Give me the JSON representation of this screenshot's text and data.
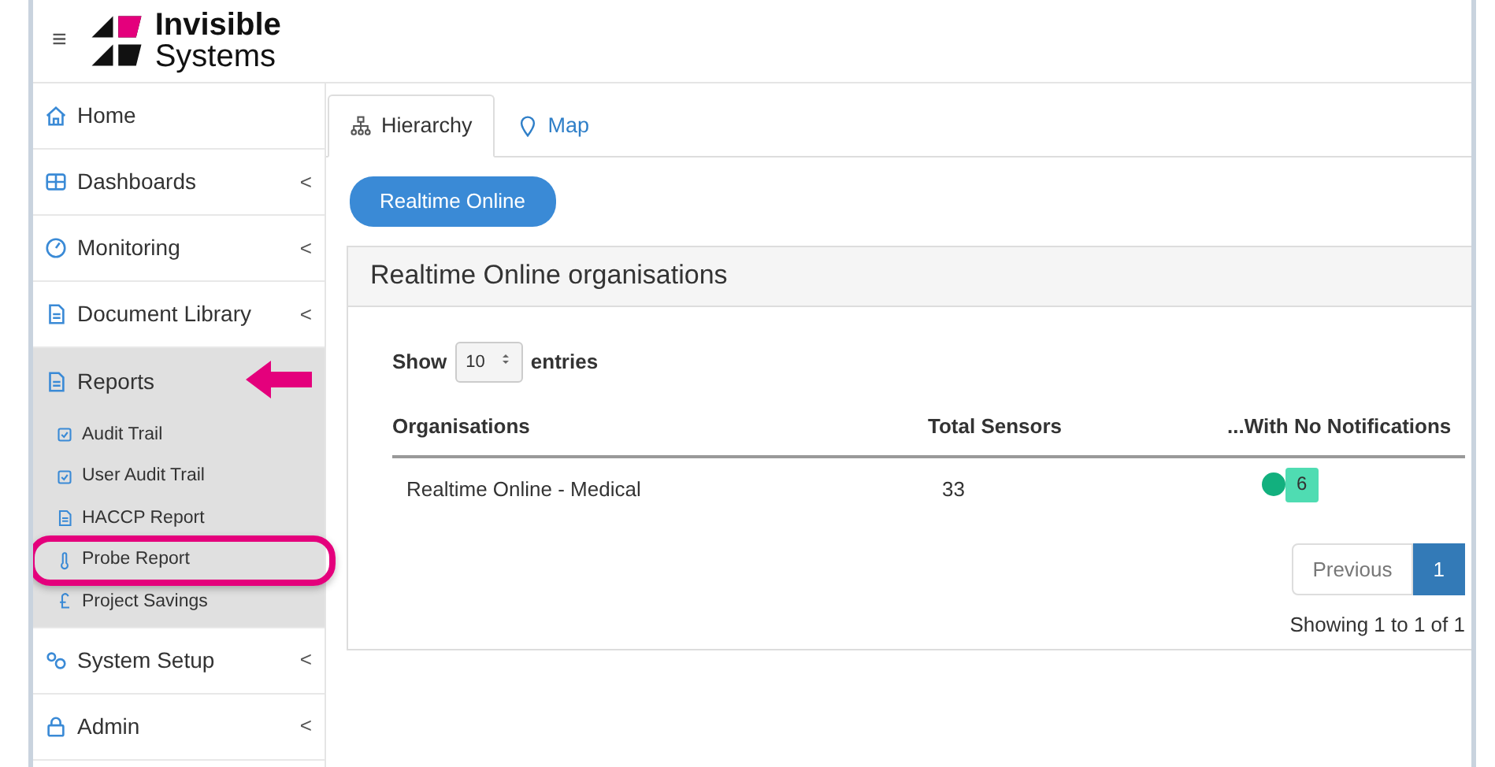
{
  "header": {
    "menu_glyph": "≡",
    "logo": {
      "line_1": "Invisible",
      "line_2": "Systems"
    }
  },
  "sidebar": {
    "items": [
      {
        "label": "Home",
        "expanded": false,
        "arrow_marker": false
      },
      {
        "label": "Dashboards",
        "chevron": "<",
        "expanded": false,
        "arrow_marker": false
      },
      {
        "label": "Monitoring",
        "chevron": "<",
        "expanded": false,
        "arrow_marker": false
      },
      {
        "label": "Document Library",
        "chevron": "<",
        "expanded": false,
        "arrow_marker": false
      },
      {
        "label": "Reports",
        "expanded": true,
        "arrow_marker": true,
        "children": [
          {
            "label": "Audit Trail",
            "highlighted": false
          },
          {
            "label": "User Audit Trail",
            "highlighted": false
          },
          {
            "label": "HACCP Report",
            "highlighted": false
          },
          {
            "label": "Probe Report",
            "highlighted": true
          },
          {
            "label": "Project Savings",
            "highlighted": false
          }
        ]
      },
      {
        "label": "System Setup",
        "chevron": "<",
        "expanded": false,
        "arrow_marker": false
      },
      {
        "label": "Admin",
        "chevron": "<",
        "expanded": false,
        "arrow_marker": false
      }
    ]
  },
  "tabs": [
    {
      "label": "Hierarchy",
      "selected": true
    },
    {
      "label": "Map",
      "selected": false
    }
  ],
  "breadcrumb_button": "Realtime Online",
  "panel": {
    "title": "Realtime Online organisations",
    "length": {
      "show": "Show",
      "value": "10",
      "entries": "entries"
    },
    "table": {
      "columns": [
        "Organisations",
        "Total Sensors",
        "...With No Notifications"
      ],
      "rows": [
        {
          "organisation": "Realtime Online - Medical",
          "total_sensors": "33",
          "no_notifications": {
            "color": "#12b07e",
            "count": "6"
          }
        }
      ]
    },
    "pagination": [
      {
        "label": "Previous",
        "selected": false
      },
      {
        "label": "1",
        "selected": true
      }
    ],
    "info": "Showing 1 to 1 of 1"
  }
}
